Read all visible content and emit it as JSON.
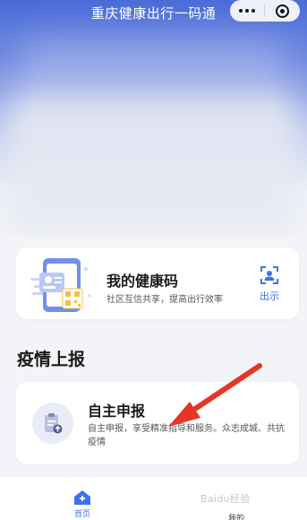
{
  "app": {
    "title": "重庆健康出行一码通"
  },
  "health_code": {
    "title": "我的健康码",
    "subtitle": "社区互信共享，提高出行效率",
    "show_label": "出示"
  },
  "section": {
    "title": "疫情上报"
  },
  "self_report": {
    "title": "自主申报",
    "description": "自主申报，享受精准指导和服务。众志成城、共抗疫情"
  },
  "tabbar": {
    "home_label": "首页",
    "mine_label": "我的"
  },
  "watermark": "Baidu经验",
  "colors": {
    "accent": "#3b74e6",
    "annotation_arrow": "#e53528"
  }
}
